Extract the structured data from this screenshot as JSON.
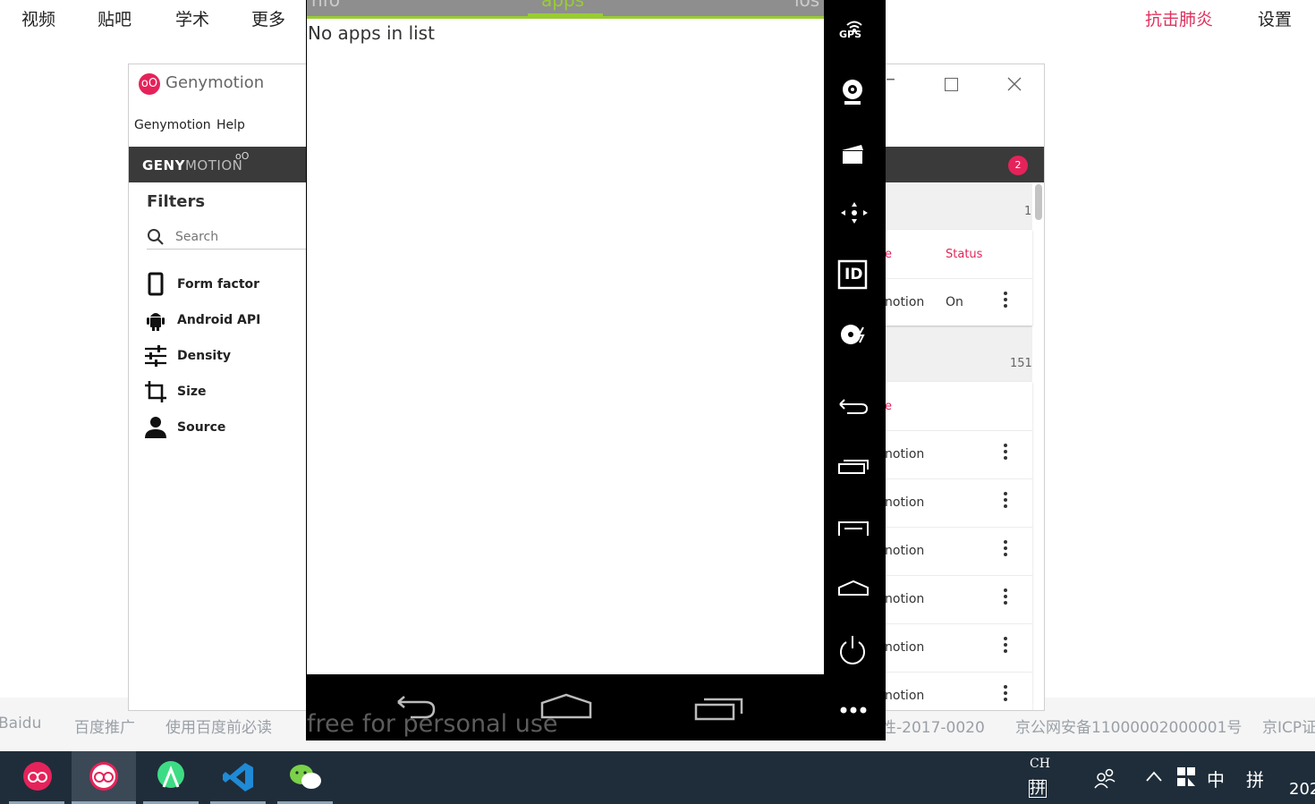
{
  "baidu": {
    "nav": [
      "视频",
      "贴吧",
      "学术",
      "更多"
    ],
    "right": {
      "highlight": "抗击肺炎",
      "settings": "设置"
    },
    "footer": [
      "Baidu",
      "百度推广",
      "使用百度前必读",
      "性-2017-0020",
      "京公网安备11000002000001号",
      "京ICP证"
    ]
  },
  "genymotion": {
    "window_title": "Genymotion",
    "logo_glyph": "oO",
    "menu": [
      "Genymotion",
      "Help"
    ],
    "brand": {
      "bold": "GENY",
      "thin": "MOTION",
      "mark": "oO"
    },
    "notifications_badge": "2",
    "filters": {
      "title": "Filters",
      "search_placeholder": "Search",
      "items": [
        "Form factor",
        "Android API",
        "Density",
        "Size",
        "Source"
      ]
    },
    "devices": {
      "my_count": "1",
      "columns": [
        "e",
        "Status"
      ],
      "my_row": {
        "name": "notion",
        "status": "On"
      },
      "available_count": "151",
      "available_header": "e",
      "available_rows": [
        "notion",
        "notion",
        "notion",
        "notion",
        "notion",
        "notion"
      ]
    }
  },
  "device": {
    "tabs": [
      "nfo",
      "apps",
      "ios"
    ],
    "active_tab": "apps",
    "empty_text": "No apps in list",
    "watermark": "free for personal use",
    "toolbar_icons": [
      "gps-icon",
      "webcam-icon",
      "capture-icon",
      "dpad-icon",
      "id-icon",
      "disk-io-icon",
      "back-icon",
      "recent-apps-icon",
      "menu-icon",
      "home-icon",
      "power-icon",
      "more-icon"
    ],
    "gps_label": "GPS",
    "id_label": "ID"
  },
  "taskbar": {
    "apps": [
      "genymotion-icon",
      "genymotion-player-icon",
      "android-studio-icon",
      "vscode-icon",
      "wechat-icon"
    ],
    "lang_top": "CH",
    "lang_bottom": "拼",
    "ime_mode": "中",
    "ime_pinyin": "拼",
    "clock_partial": "202"
  },
  "colors": {
    "accent_pink": "#e5235a",
    "android_green": "#99cc33",
    "taskbar": "#1f2d3a"
  }
}
